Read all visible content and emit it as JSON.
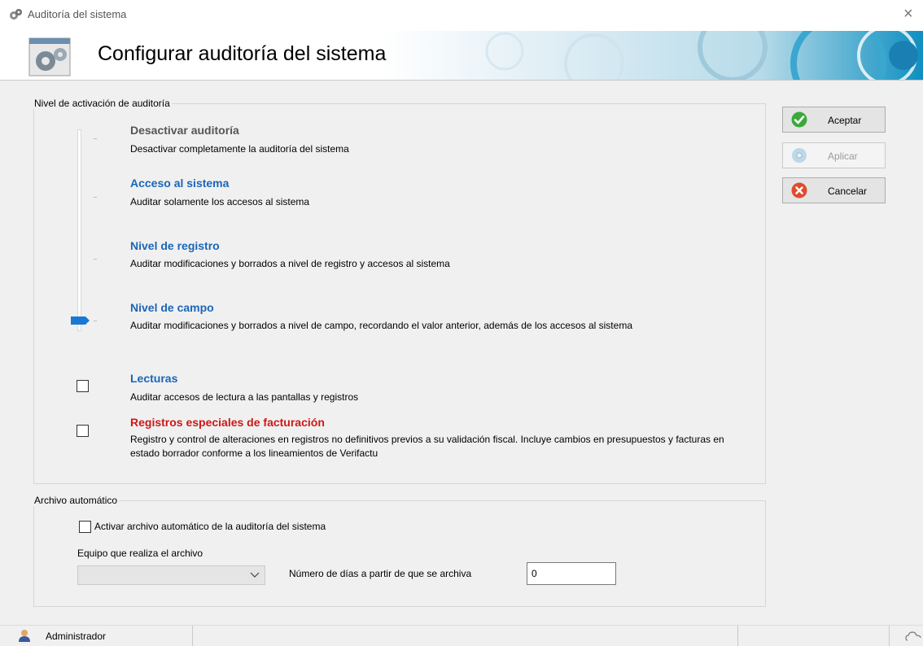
{
  "window": {
    "title": "Auditoría del sistema",
    "close_glyph": "×"
  },
  "header": {
    "title": "Configurar auditoría del sistema",
    "icon": "gears-window-icon"
  },
  "activation_group": {
    "legend": "Nivel de activación de auditoría",
    "selected_level": "Nivel de campo",
    "levels": [
      {
        "title": "Desactivar auditoría",
        "description": "Desactivar completamente la auditoría del sistema"
      },
      {
        "title": "Acceso al sistema",
        "description": "Auditar solamente los accesos al sistema"
      },
      {
        "title": "Nivel de registro",
        "description": "Auditar modificaciones y borrados a nivel de registro y accesos al sistema"
      },
      {
        "title": "Nivel de campo",
        "description": "Auditar modificaciones y borrados a nivel de campo, recordando el valor anterior, además de los accesos al sistema"
      }
    ],
    "options": [
      {
        "title": "Lecturas",
        "description": "Auditar accesos de lectura a las pantallas y registros",
        "checked": false
      },
      {
        "title": "Registros especiales de facturación",
        "description": "Registro y control de alteraciones en registros no definitivos previos a su validación fiscal. Incluye cambios en presupuestos y facturas en estado borrador conforme a los lineamientos de Verifactu",
        "checked": false
      }
    ]
  },
  "buttons": {
    "accept": {
      "label": "Aceptar",
      "icon": "check-icon",
      "enabled": true
    },
    "apply": {
      "label": "Aplicar",
      "icon": "disc-icon",
      "enabled": false
    },
    "cancel": {
      "label": "Cancelar",
      "icon": "cancel-icon",
      "enabled": true
    }
  },
  "archive_group": {
    "legend": "Archivo automático",
    "enable_label": "Activar archivo automático de la auditoría del sistema",
    "enable_checked": false,
    "machine_label": "Equipo que realiza el archivo",
    "machine_value": "",
    "days_label": "Número de días a partir de que se archiva",
    "days_value": "0"
  },
  "statusbar": {
    "user": "Administrador",
    "user_icon": "user-icon"
  },
  "colors": {
    "level_title": "#1a66b8",
    "special_title": "#cc1818",
    "slider_thumb": "#1979d2"
  }
}
